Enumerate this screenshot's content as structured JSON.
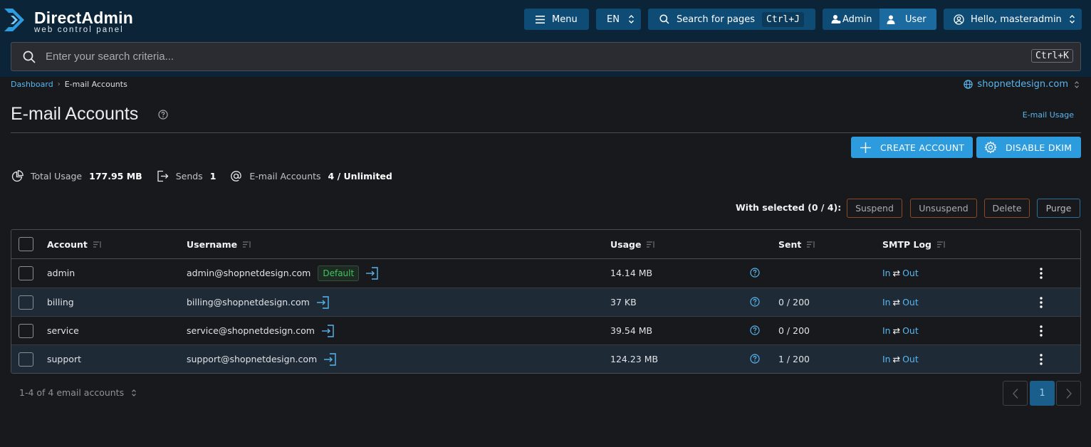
{
  "brand": {
    "title": "DirectAdmin",
    "subtitle": "web control panel",
    "accent": "#2d9cde"
  },
  "topbar": {
    "menu_label": "Menu",
    "language": "EN",
    "search_label": "Search for pages",
    "search_shortcut": "Ctrl+J",
    "role_admin": "Admin",
    "role_user": "User",
    "greeting": "Hello, masteradmin"
  },
  "search": {
    "placeholder": "Enter your search criteria...",
    "shortcut": "Ctrl+K"
  },
  "breadcrumb": {
    "home": "Dashboard",
    "current": "E-mail Accounts"
  },
  "domain": "shopnetdesign.com",
  "page": {
    "title": "E-mail Accounts",
    "usage_link": "E-mail Usage"
  },
  "actions": {
    "create": "CREATE ACCOUNT",
    "dkim": "DISABLE DKIM"
  },
  "stats": {
    "usage_label": "Total Usage",
    "usage_value": "177.95 MB",
    "sends_label": "Sends",
    "sends_value": "1",
    "accounts_label": "E-mail Accounts",
    "accounts_value": "4 / Unlimited"
  },
  "bulk": {
    "label": "With selected (0 / 4):",
    "suspend": "Suspend",
    "unsuspend": "Unsuspend",
    "delete": "Delete",
    "purge": "Purge"
  },
  "table": {
    "columns": {
      "account": "Account",
      "username": "Username",
      "usage": "Usage",
      "sent": "Sent",
      "smtp": "SMTP Log"
    },
    "smtp_in": "In",
    "smtp_arrow": "⇄",
    "smtp_out": "Out",
    "rows": [
      {
        "account": "admin",
        "username": "admin@shopnetdesign.com",
        "badge": "Default",
        "usage": "14.14 MB",
        "sent": ""
      },
      {
        "account": "billing",
        "username": "billing@shopnetdesign.com",
        "usage": "37 KB",
        "sent": "0 / 200"
      },
      {
        "account": "service",
        "username": "service@shopnetdesign.com",
        "usage": "39.54 MB",
        "sent": "0 / 200"
      },
      {
        "account": "support",
        "username": "support@shopnetdesign.com",
        "usage": "124.23 MB",
        "sent": "1 / 200"
      }
    ]
  },
  "footer": {
    "count": "1-4 of 4 email accounts",
    "current_page": "1"
  }
}
